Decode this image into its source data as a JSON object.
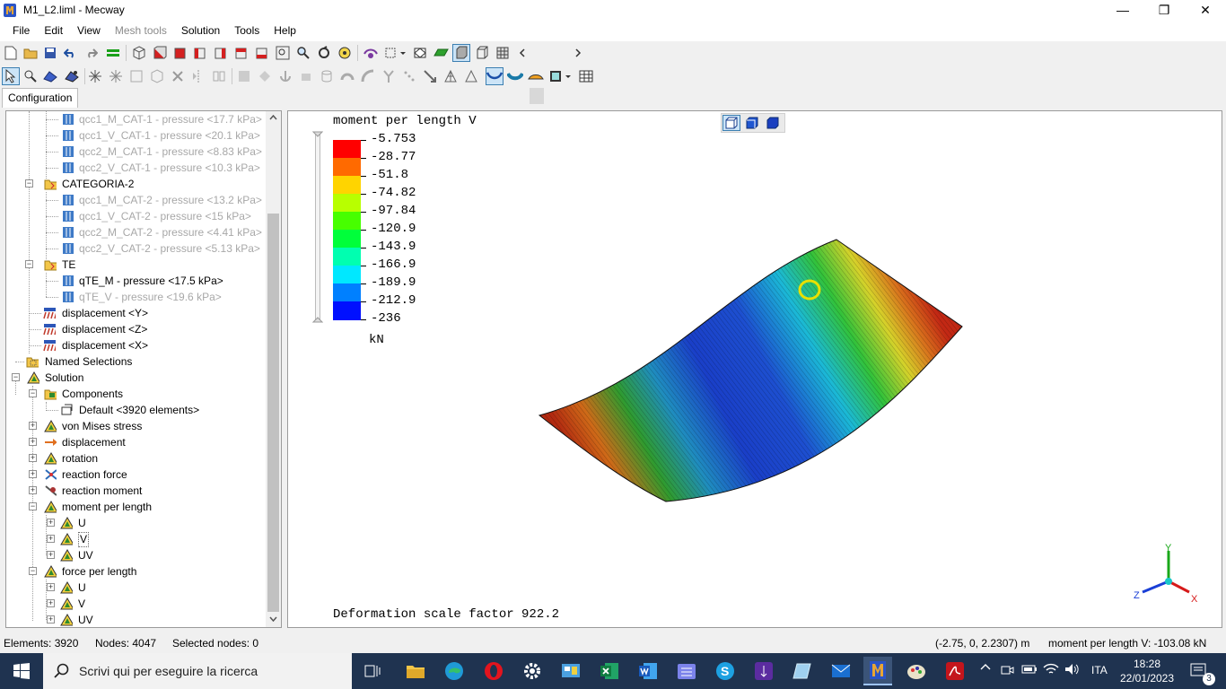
{
  "window": {
    "title": "M1_L2.liml - Mecway",
    "minimize": "—",
    "maximize": "❐",
    "close": "✕"
  },
  "menu": [
    {
      "label": "File",
      "enabled": true
    },
    {
      "label": "Edit",
      "enabled": true
    },
    {
      "label": "View",
      "enabled": true
    },
    {
      "label": "Mesh tools",
      "enabled": false
    },
    {
      "label": "Solution",
      "enabled": true
    },
    {
      "label": "Tools",
      "enabled": true
    },
    {
      "label": "Help",
      "enabled": true
    }
  ],
  "tabs": {
    "configuration": "Configuration"
  },
  "tree": {
    "qcc1_M_CAT_1": "qcc1_M_CAT-1 - pressure <17.7 kPa>",
    "qcc1_V_CAT_1": "qcc1_V_CAT-1 - pressure <20.1 kPa>",
    "qcc2_M_CAT_1": "qcc2_M_CAT-1 - pressure <8.83 kPa>",
    "qcc2_V_CAT_1": "qcc2_V_CAT-1 - pressure <10.3 kPa>",
    "categoria2": "CATEGORIA-2",
    "qcc1_M_CAT_2": "qcc1_M_CAT-2 - pressure <13.2 kPa>",
    "qcc1_V_CAT_2": "qcc1_V_CAT-2 - pressure <15 kPa>",
    "qcc2_M_CAT_2": "qcc2_M_CAT-2 - pressure <4.41 kPa>",
    "qcc2_V_CAT_2": "qcc2_V_CAT-2 - pressure <5.13 kPa>",
    "te": "TE",
    "qTE_M": "qTE_M - pressure <17.5 kPa>",
    "qTE_V": "qTE_V - pressure <19.6 kPa>",
    "dispY": "displacement <Y>",
    "dispZ": "displacement <Z>",
    "dispX": "displacement <X>",
    "namedSelections": "Named Selections",
    "solution": "Solution",
    "components": "Components",
    "default": "Default <3920 elements>",
    "vonMises": "von Mises stress",
    "displacement": "displacement",
    "rotation": "rotation",
    "reactionForce": "reaction force",
    "reactionMoment": "reaction moment",
    "momentPerLength": "moment per length",
    "mU": "U",
    "mV": "V",
    "mUV": "UV",
    "forcePerLength": "force per length",
    "fU": "U",
    "fV": "V",
    "fUV": "UV"
  },
  "viewport": {
    "title": "moment per length V",
    "unit": "kN",
    "deformation": "Deformation scale factor 922.2",
    "legend_values": [
      "-5.753",
      "-28.77",
      "-51.8",
      "-74.82",
      "-97.84",
      "-120.9",
      "-143.9",
      "-166.9",
      "-189.9",
      "-212.9",
      "-236"
    ],
    "legend_colors": [
      "#ff0000",
      "#ff6a00",
      "#ffd400",
      "#b8ff00",
      "#47ff00",
      "#00ff3a",
      "#00ffb0",
      "#00e8ff",
      "#0080ff",
      "#0010ff"
    ],
    "axes": {
      "x": "X",
      "y": "Y",
      "z": "Z"
    }
  },
  "status": {
    "elements": "Elements: 3920",
    "nodes": "Nodes: 4047",
    "selected": "Selected nodes: 0",
    "coords": "(-2.75, 0, 2.2307) m",
    "value": "moment per length V: -103.08 kN"
  },
  "taskbar": {
    "search_placeholder": "Scrivi qui per eseguire la ricerca",
    "lang": "ITA",
    "time": "18:28",
    "date": "22/01/2023",
    "notifications": "3"
  }
}
